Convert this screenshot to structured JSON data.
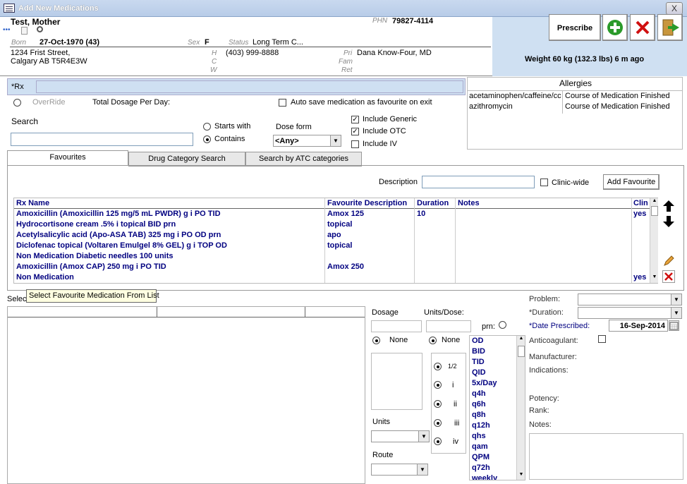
{
  "window": {
    "title": "Add New Medications",
    "close_label": "X"
  },
  "patient": {
    "name": "Test, Mother",
    "phn_label": "PHN",
    "phn": "79827-4114",
    "born_label": "Born",
    "born": "27-Oct-1970 (43)",
    "sex_label": "Sex",
    "sex": "F",
    "status_label": "Status",
    "status": "Long Term C...",
    "address1": "1234 Frist Street,",
    "address2": "Calgary AB  T5R4E3W",
    "h_label": "H",
    "c_label": "C",
    "w_label": "W",
    "phone": "(403) 999-8888",
    "pri_label": "Pri",
    "fam_label": "Fam",
    "ret_label": "Ret",
    "pri": "Dana Know-Four, MD"
  },
  "toolbar": {
    "prescribe": "Prescribe",
    "weight": "Weight 60 kg  (132.3 lbs)  6 m ago"
  },
  "rx": {
    "label": "*Rx",
    "override": "OverRide",
    "total_dosage": "Total Dosage Per Day:",
    "autosave": "Auto save medication as favourite on exit"
  },
  "allergies": {
    "title": "Allergies",
    "items": [
      {
        "name": "acetaminophen/caffeine/cc",
        "status": "Course of Medication Finished"
      },
      {
        "name": "azithromycin",
        "status": "Course of Medication Finished"
      }
    ]
  },
  "search": {
    "label": "Search",
    "starts_with": "Starts with",
    "contains": "Contains",
    "dose_form_label": "Dose form",
    "dose_form_value": "<Any>",
    "include_generic": "Include Generic",
    "include_otc": "Include OTC",
    "include_iv": "Include IV"
  },
  "tabs": [
    "Favourites",
    "Drug Category Search",
    "Search by ATC categories"
  ],
  "favourites": {
    "description_label": "Description",
    "clinic_wide": "Clinic-wide",
    "add_favourite": "Add Favourite",
    "columns": [
      "Rx Name",
      "Favourite Description",
      "Duration",
      "Notes",
      "Clin"
    ],
    "rows": [
      {
        "rx": "Amoxicillin (Amoxicillin 125 mg/5 mL PWDR)   g   i PO  TID",
        "desc": "Amox 125",
        "dur": "10",
        "notes": "",
        "clin": "yes"
      },
      {
        "rx": "Hydrocortisone cream .5%    i topical  BID prn",
        "desc": "topical",
        "dur": "",
        "notes": "",
        "clin": ""
      },
      {
        "rx": "Acetylsalicylic acid (Apo-ASA TAB) 325  mg   i PO  OD prn",
        "desc": "apo",
        "dur": "",
        "notes": "",
        "clin": ""
      },
      {
        "rx": "Diclofenac topical (Voltaren Emulgel 8% GEL)   g   i TOP  OD",
        "desc": "topical",
        "dur": "",
        "notes": "",
        "clin": ""
      },
      {
        "rx": "Non Medication       Diabetic needles 100 units",
        "desc": "",
        "dur": "",
        "notes": "",
        "clin": ""
      },
      {
        "rx": "Amoxicillin (Amox CAP) 250  mg   i PO  TID",
        "desc": "Amox 250",
        "dur": "",
        "notes": "",
        "clin": ""
      },
      {
        "rx": "Non Medication",
        "desc": "",
        "dur": "",
        "notes": "",
        "clin": "yes"
      }
    ]
  },
  "tooltip": "Select Favourite Medication From List",
  "select_label": "Selec",
  "dosage": {
    "dosage_label": "Dosage",
    "units_dose_label": "Units/Dose:",
    "prn_label": "prn:",
    "none1": "None",
    "none2": "None",
    "fractions": [
      "1/2",
      "i",
      "ii",
      "iii",
      "iv"
    ],
    "units_label": "Units",
    "route_label": "Route",
    "frequencies": [
      "OD",
      "BID",
      "TID",
      "QID",
      "5x/Day",
      "q4h",
      "q6h",
      "q8h",
      "q12h",
      "qhs",
      "qam",
      "QPM",
      "q72h",
      "weekly"
    ]
  },
  "details": {
    "problem": "Problem:",
    "duration": "*Duration:",
    "date_prescribed_label": "*Date Prescribed:",
    "date_prescribed": "16-Sep-2014",
    "anticoagulant": "Anticoagulant:",
    "manufacturer": "Manufacturer:",
    "indications": "Indications:",
    "potency": "Potency:",
    "rank": "Rank:",
    "notes": "Notes:"
  }
}
